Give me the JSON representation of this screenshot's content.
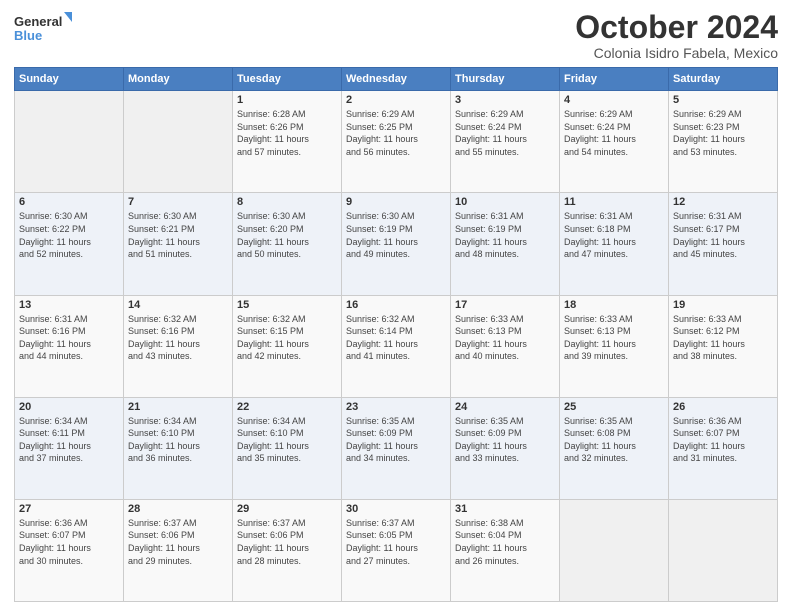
{
  "logo": {
    "line1": "General",
    "line2": "Blue"
  },
  "header": {
    "month": "October 2024",
    "location": "Colonia Isidro Fabela, Mexico"
  },
  "weekdays": [
    "Sunday",
    "Monday",
    "Tuesday",
    "Wednesday",
    "Thursday",
    "Friday",
    "Saturday"
  ],
  "weeks": [
    [
      {
        "day": "",
        "sunrise": "",
        "sunset": "",
        "daylight": ""
      },
      {
        "day": "",
        "sunrise": "",
        "sunset": "",
        "daylight": ""
      },
      {
        "day": "1",
        "sunrise": "Sunrise: 6:28 AM",
        "sunset": "Sunset: 6:26 PM",
        "daylight": "Daylight: 11 hours and 57 minutes."
      },
      {
        "day": "2",
        "sunrise": "Sunrise: 6:29 AM",
        "sunset": "Sunset: 6:25 PM",
        "daylight": "Daylight: 11 hours and 56 minutes."
      },
      {
        "day": "3",
        "sunrise": "Sunrise: 6:29 AM",
        "sunset": "Sunset: 6:24 PM",
        "daylight": "Daylight: 11 hours and 55 minutes."
      },
      {
        "day": "4",
        "sunrise": "Sunrise: 6:29 AM",
        "sunset": "Sunset: 6:24 PM",
        "daylight": "Daylight: 11 hours and 54 minutes."
      },
      {
        "day": "5",
        "sunrise": "Sunrise: 6:29 AM",
        "sunset": "Sunset: 6:23 PM",
        "daylight": "Daylight: 11 hours and 53 minutes."
      }
    ],
    [
      {
        "day": "6",
        "sunrise": "Sunrise: 6:30 AM",
        "sunset": "Sunset: 6:22 PM",
        "daylight": "Daylight: 11 hours and 52 minutes."
      },
      {
        "day": "7",
        "sunrise": "Sunrise: 6:30 AM",
        "sunset": "Sunset: 6:21 PM",
        "daylight": "Daylight: 11 hours and 51 minutes."
      },
      {
        "day": "8",
        "sunrise": "Sunrise: 6:30 AM",
        "sunset": "Sunset: 6:20 PM",
        "daylight": "Daylight: 11 hours and 50 minutes."
      },
      {
        "day": "9",
        "sunrise": "Sunrise: 6:30 AM",
        "sunset": "Sunset: 6:19 PM",
        "daylight": "Daylight: 11 hours and 49 minutes."
      },
      {
        "day": "10",
        "sunrise": "Sunrise: 6:31 AM",
        "sunset": "Sunset: 6:19 PM",
        "daylight": "Daylight: 11 hours and 48 minutes."
      },
      {
        "day": "11",
        "sunrise": "Sunrise: 6:31 AM",
        "sunset": "Sunset: 6:18 PM",
        "daylight": "Daylight: 11 hours and 47 minutes."
      },
      {
        "day": "12",
        "sunrise": "Sunrise: 6:31 AM",
        "sunset": "Sunset: 6:17 PM",
        "daylight": "Daylight: 11 hours and 45 minutes."
      }
    ],
    [
      {
        "day": "13",
        "sunrise": "Sunrise: 6:31 AM",
        "sunset": "Sunset: 6:16 PM",
        "daylight": "Daylight: 11 hours and 44 minutes."
      },
      {
        "day": "14",
        "sunrise": "Sunrise: 6:32 AM",
        "sunset": "Sunset: 6:16 PM",
        "daylight": "Daylight: 11 hours and 43 minutes."
      },
      {
        "day": "15",
        "sunrise": "Sunrise: 6:32 AM",
        "sunset": "Sunset: 6:15 PM",
        "daylight": "Daylight: 11 hours and 42 minutes."
      },
      {
        "day": "16",
        "sunrise": "Sunrise: 6:32 AM",
        "sunset": "Sunset: 6:14 PM",
        "daylight": "Daylight: 11 hours and 41 minutes."
      },
      {
        "day": "17",
        "sunrise": "Sunrise: 6:33 AM",
        "sunset": "Sunset: 6:13 PM",
        "daylight": "Daylight: 11 hours and 40 minutes."
      },
      {
        "day": "18",
        "sunrise": "Sunrise: 6:33 AM",
        "sunset": "Sunset: 6:13 PM",
        "daylight": "Daylight: 11 hours and 39 minutes."
      },
      {
        "day": "19",
        "sunrise": "Sunrise: 6:33 AM",
        "sunset": "Sunset: 6:12 PM",
        "daylight": "Daylight: 11 hours and 38 minutes."
      }
    ],
    [
      {
        "day": "20",
        "sunrise": "Sunrise: 6:34 AM",
        "sunset": "Sunset: 6:11 PM",
        "daylight": "Daylight: 11 hours and 37 minutes."
      },
      {
        "day": "21",
        "sunrise": "Sunrise: 6:34 AM",
        "sunset": "Sunset: 6:10 PM",
        "daylight": "Daylight: 11 hours and 36 minutes."
      },
      {
        "day": "22",
        "sunrise": "Sunrise: 6:34 AM",
        "sunset": "Sunset: 6:10 PM",
        "daylight": "Daylight: 11 hours and 35 minutes."
      },
      {
        "day": "23",
        "sunrise": "Sunrise: 6:35 AM",
        "sunset": "Sunset: 6:09 PM",
        "daylight": "Daylight: 11 hours and 34 minutes."
      },
      {
        "day": "24",
        "sunrise": "Sunrise: 6:35 AM",
        "sunset": "Sunset: 6:09 PM",
        "daylight": "Daylight: 11 hours and 33 minutes."
      },
      {
        "day": "25",
        "sunrise": "Sunrise: 6:35 AM",
        "sunset": "Sunset: 6:08 PM",
        "daylight": "Daylight: 11 hours and 32 minutes."
      },
      {
        "day": "26",
        "sunrise": "Sunrise: 6:36 AM",
        "sunset": "Sunset: 6:07 PM",
        "daylight": "Daylight: 11 hours and 31 minutes."
      }
    ],
    [
      {
        "day": "27",
        "sunrise": "Sunrise: 6:36 AM",
        "sunset": "Sunset: 6:07 PM",
        "daylight": "Daylight: 11 hours and 30 minutes."
      },
      {
        "day": "28",
        "sunrise": "Sunrise: 6:37 AM",
        "sunset": "Sunset: 6:06 PM",
        "daylight": "Daylight: 11 hours and 29 minutes."
      },
      {
        "day": "29",
        "sunrise": "Sunrise: 6:37 AM",
        "sunset": "Sunset: 6:06 PM",
        "daylight": "Daylight: 11 hours and 28 minutes."
      },
      {
        "day": "30",
        "sunrise": "Sunrise: 6:37 AM",
        "sunset": "Sunset: 6:05 PM",
        "daylight": "Daylight: 11 hours and 27 minutes."
      },
      {
        "day": "31",
        "sunrise": "Sunrise: 6:38 AM",
        "sunset": "Sunset: 6:04 PM",
        "daylight": "Daylight: 11 hours and 26 minutes."
      },
      {
        "day": "",
        "sunrise": "",
        "sunset": "",
        "daylight": ""
      },
      {
        "day": "",
        "sunrise": "",
        "sunset": "",
        "daylight": ""
      }
    ]
  ]
}
